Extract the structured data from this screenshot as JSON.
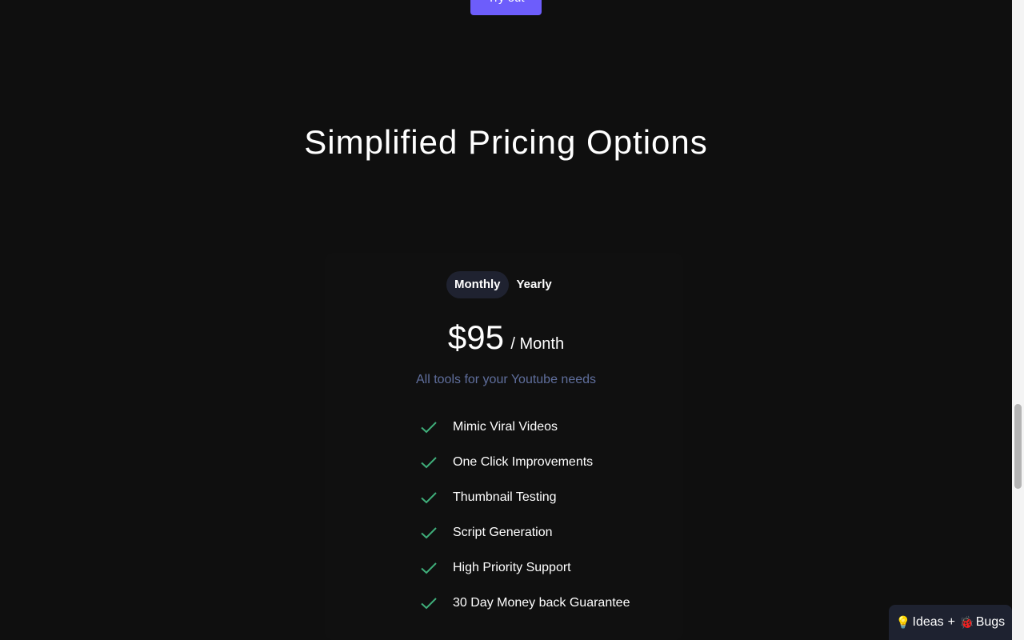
{
  "hero": {
    "try_button_label": "Try out"
  },
  "pricing": {
    "title": "Simplified Pricing Options",
    "toggle": {
      "monthly_label": "Monthly",
      "yearly_label": "Yearly",
      "selected": "Monthly"
    },
    "price": "$95",
    "period": "/ Month",
    "tagline": "All tools for your Youtube needs",
    "features": [
      {
        "label": "Mimic Viral Videos",
        "icon": "check-icon"
      },
      {
        "label": "One Click Improvements",
        "icon": "check-icon"
      },
      {
        "label": "Thumbnail Testing",
        "icon": "check-icon"
      },
      {
        "label": "Script Generation",
        "icon": "check-icon"
      },
      {
        "label": "High Priority Support",
        "icon": "check-icon"
      },
      {
        "label": "30 Day Money back Guarantee",
        "icon": "check-icon"
      }
    ]
  },
  "feedback": {
    "ideas_emoji": "💡",
    "ideas_label": "Ideas",
    "plus": "+",
    "bugs_emoji": "🐞",
    "bugs_label": "Bugs"
  },
  "colors": {
    "background": "#0f0f0f",
    "accent": "#6d5dfb",
    "check": "#3fae7a",
    "tagline": "#5f6e9c",
    "toggle_active": "#1f2230"
  }
}
